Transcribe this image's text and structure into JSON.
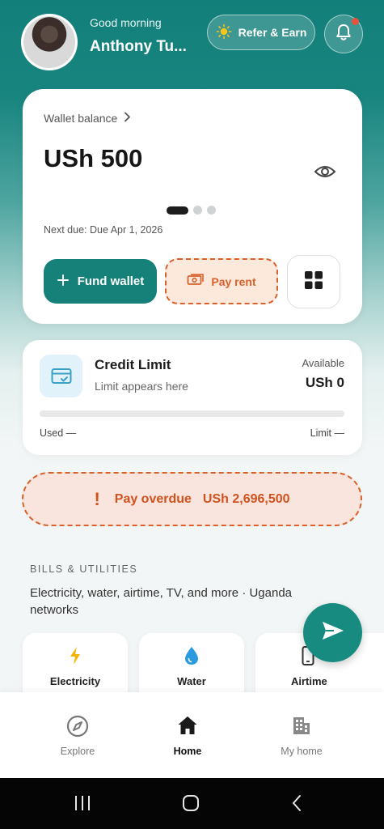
{
  "header": {
    "greeting": "Good morning",
    "username": "Anthony Tu...",
    "refer_label": "Refer & Earn",
    "avatar_icon": "avatar",
    "sun_icon": "sun-icon",
    "bell_icon": "bell-icon",
    "has_notification": true
  },
  "wallet": {
    "label": "Wallet balance",
    "amount": "USh 500",
    "next_due": "Next due: Due Apr 1, 2026",
    "fund_label": "Fund wallet",
    "pay_rent_label": "Pay rent",
    "carousel_pages": 3,
    "carousel_active": 1
  },
  "credit": {
    "title": "Credit Limit",
    "subtitle": "Limit appears here",
    "available_label": "Available",
    "available_value": "USh 0",
    "used_label": "Used —",
    "limit_label": "Limit —",
    "usage_fraction": 0
  },
  "overdue": {
    "label": "Pay overdue",
    "amount": "USh 2,696,500"
  },
  "bills": {
    "heading": "BILLS & UTILITIES",
    "description": "Electricity, water, airtime, TV, and more · Uganda networks",
    "tiles": [
      {
        "label": "Electricity",
        "icon": "lightning-icon"
      },
      {
        "label": "Water",
        "icon": "water-drop-icon"
      },
      {
        "label": "Airtime",
        "icon": "phone-icon"
      }
    ]
  },
  "bottom_nav": {
    "items": [
      {
        "label": "Explore",
        "icon": "compass-icon"
      },
      {
        "label": "Home",
        "icon": "home-icon",
        "active": true
      },
      {
        "label": "My home",
        "icon": "building-icon"
      }
    ]
  },
  "colors": {
    "brand": "#158178",
    "accent_orange": "#d9622b",
    "overdue_bg": "#f9e5dd"
  }
}
